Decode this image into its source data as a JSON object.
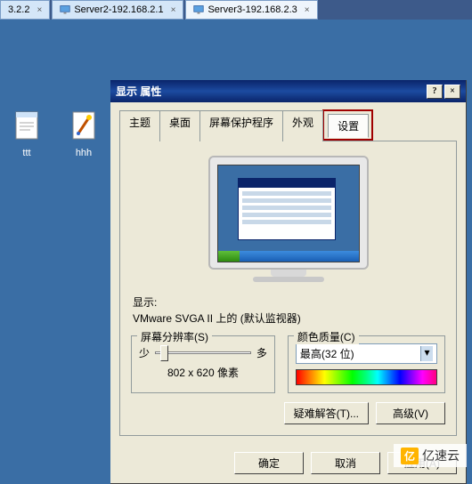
{
  "tabs": [
    {
      "label": "3.2.2"
    },
    {
      "label": "Server2-192.168.2.1"
    },
    {
      "label": "Server3-192.168.2.3"
    }
  ],
  "desktop_icons": [
    {
      "label": "ttt"
    },
    {
      "label": "hhh"
    }
  ],
  "dialog": {
    "title": "显示 属性",
    "help": "?",
    "close": "×",
    "tabs": {
      "theme": "主题",
      "desktop": "桌面",
      "screensaver": "屏幕保护程序",
      "appearance": "外观",
      "settings": "设置"
    },
    "display_heading": "显示:",
    "display_device": "VMware SVGA II 上的 (默认监视器)",
    "resolution": {
      "legend": "屏幕分辨率(S)",
      "less": "少",
      "more": "多",
      "value": "802 x 620 像素"
    },
    "color": {
      "legend": "颜色质量(C)",
      "value": "最高(32 位)"
    },
    "troubleshoot": "疑难解答(T)...",
    "advanced": "高级(V)",
    "ok": "确定",
    "cancel": "取消",
    "apply": "应用(A)"
  },
  "preview": {
    "start_label": "start"
  },
  "watermark": {
    "badge": "亿",
    "text": "亿速云"
  }
}
